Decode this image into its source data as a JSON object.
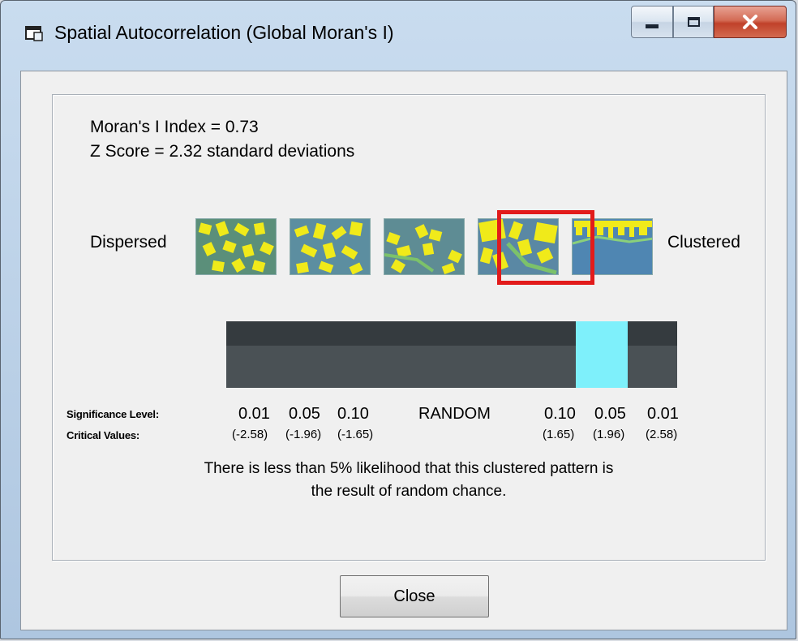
{
  "window": {
    "title": "Spatial Autocorrelation (Global Moran's I)",
    "controls": {
      "minimize": "minimize-icon",
      "maximize": "maximize-icon",
      "close": "close-icon"
    }
  },
  "stats": {
    "morans_i": "Moran's I Index = 0.73",
    "z_score": "Z Score = 2.32 standard deviations"
  },
  "scale": {
    "left_label": "Dispersed",
    "right_label": "Clustered",
    "selected_pattern_index": 3,
    "pattern_count": 5
  },
  "significance": {
    "level_label": "Significance Level:",
    "critical_label": "Critical Values:",
    "levels": [
      "0.01",
      "0.05",
      "0.10",
      "RANDOM",
      "0.10",
      "0.05",
      "0.01"
    ],
    "critical_values": [
      "(-2.58)",
      "(-1.96)",
      "(-1.65)",
      "(1.65)",
      "(1.96)",
      "(2.58)"
    ],
    "highlighted_band": "0.05"
  },
  "message": {
    "line1": "There is less than 5% likelihood that this clustered pattern is",
    "line2": "the result of random chance."
  },
  "buttons": {
    "close": "Close"
  },
  "colors": {
    "highlight_marker": "#7ef0fb",
    "selection_frame": "#e21b1b",
    "bar": "#3d4448"
  }
}
